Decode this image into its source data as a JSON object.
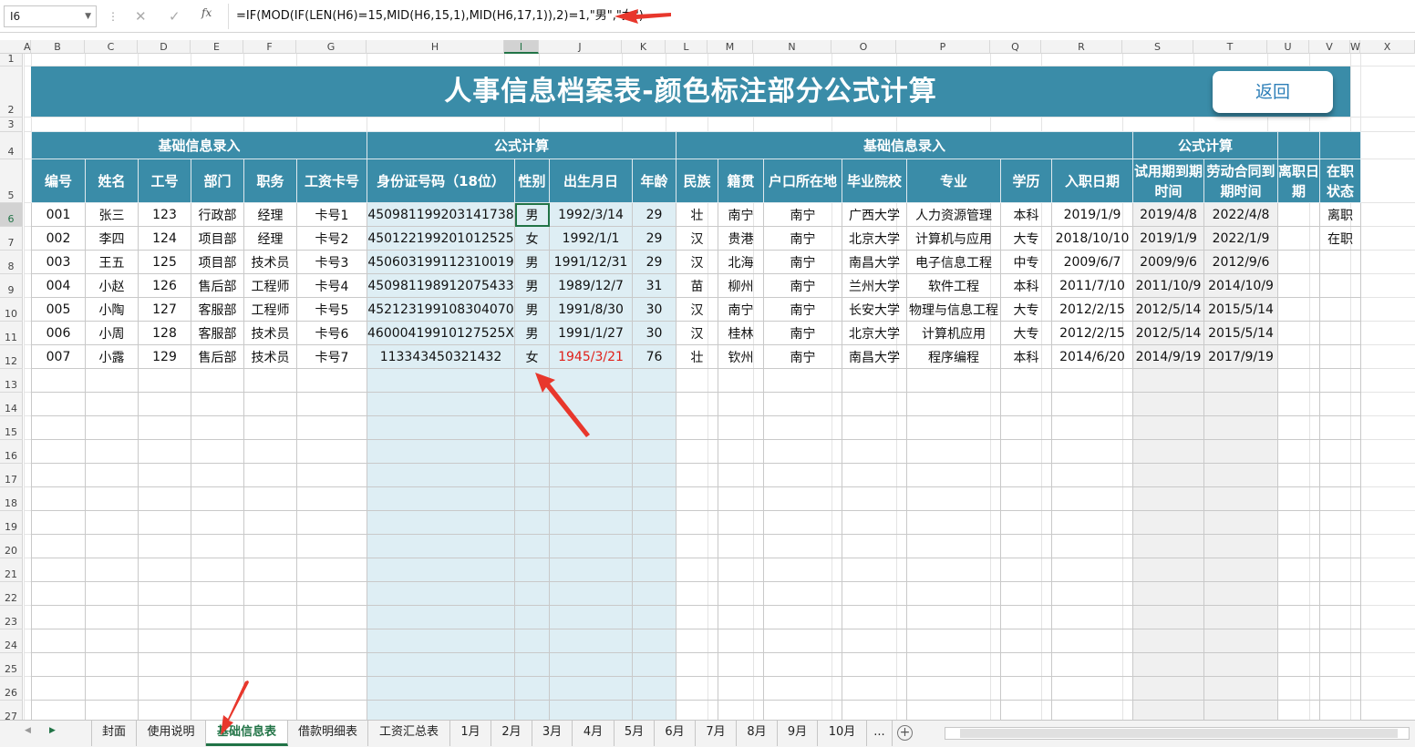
{
  "name_box": "I6",
  "formula": "=IF(MOD(IF(LEN(H6)=15,MID(H6,15,1),MID(H6,17,1)),2)=1,\"男\",\"女\")",
  "fx_label": "fx",
  "columns": [
    "A",
    "B",
    "C",
    "D",
    "E",
    "F",
    "G",
    "H",
    "I",
    "J",
    "K",
    "L",
    "M",
    "N",
    "O",
    "P",
    "Q",
    "R",
    "S",
    "T",
    "U",
    "V",
    "W",
    "X"
  ],
  "rows": [
    "1",
    "2",
    "3",
    "4",
    "5",
    "6",
    "7",
    "8",
    "9",
    "10",
    "11",
    "12",
    "13",
    "14",
    "15",
    "16",
    "17",
    "18",
    "19",
    "20",
    "21",
    "22",
    "23",
    "24",
    "25",
    "26",
    "27"
  ],
  "selected_col": "I",
  "selected_row": "6",
  "title": "人事信息档案表-颜色标注部分公式计算",
  "back_button": "返回",
  "group_headers": [
    "基础信息录入",
    "公式计算",
    "基础信息录入",
    "公式计算",
    "",
    ""
  ],
  "headers": [
    "编号",
    "姓名",
    "工号",
    "部门",
    "职务",
    "工资卡号",
    "身份证号码（18位）",
    "性别",
    "出生月日",
    "年龄",
    "民族",
    "籍贯",
    "户口所在地",
    "毕业院校",
    "专业",
    "学历",
    "入职日期",
    "试用期到期时间",
    "劳动合同到期时间",
    "离职日期",
    "在职状态"
  ],
  "table_rows": [
    [
      "001",
      "张三",
      "123",
      "行政部",
      "经理",
      "卡号1",
      "450981199203141738",
      "男",
      "1992/3/14",
      "29",
      "壮",
      "南宁",
      "南宁",
      "广西大学",
      "人力资源管理",
      "本科",
      "2019/1/9",
      "2019/4/8",
      "2022/4/8",
      "",
      "离职"
    ],
    [
      "002",
      "李四",
      "124",
      "项目部",
      "经理",
      "卡号2",
      "450122199201012525",
      "女",
      "1992/1/1",
      "29",
      "汉",
      "贵港",
      "南宁",
      "北京大学",
      "计算机与应用",
      "大专",
      "2018/10/10",
      "2019/1/9",
      "2022/1/9",
      "",
      "在职"
    ],
    [
      "003",
      "王五",
      "125",
      "项目部",
      "技术员",
      "卡号3",
      "450603199112310019",
      "男",
      "1991/12/31",
      "29",
      "汉",
      "北海",
      "南宁",
      "南昌大学",
      "电子信息工程",
      "中专",
      "2009/6/7",
      "2009/9/6",
      "2012/9/6",
      "",
      ""
    ],
    [
      "004",
      "小赵",
      "126",
      "售后部",
      "工程师",
      "卡号4",
      "450981198912075433",
      "男",
      "1989/12/7",
      "31",
      "苗",
      "柳州",
      "南宁",
      "兰州大学",
      "软件工程",
      "本科",
      "2011/7/10",
      "2011/10/9",
      "2014/10/9",
      "",
      ""
    ],
    [
      "005",
      "小陶",
      "127",
      "客服部",
      "工程师",
      "卡号5",
      "452123199108304070",
      "男",
      "1991/8/30",
      "30",
      "汉",
      "南宁",
      "南宁",
      "长安大学",
      "物理与信息工程",
      "大专",
      "2012/2/15",
      "2012/5/14",
      "2015/5/14",
      "",
      ""
    ],
    [
      "006",
      "小周",
      "128",
      "客服部",
      "技术员",
      "卡号6",
      "46000419910127525X",
      "男",
      "1991/1/27",
      "30",
      "汉",
      "桂林",
      "南宁",
      "北京大学",
      "计算机应用",
      "大专",
      "2012/2/15",
      "2012/5/14",
      "2015/5/14",
      "",
      ""
    ],
    [
      "007",
      "小露",
      "129",
      "售后部",
      "技术员",
      "卡号7",
      "113343450321432",
      "女",
      "1945/3/21",
      "76",
      "壮",
      "钦州",
      "南宁",
      "南昌大学",
      "程序编程",
      "本科",
      "2014/6/20",
      "2014/9/19",
      "2017/9/19",
      "",
      ""
    ]
  ],
  "sheet_tabs": [
    "封面",
    "使用说明",
    "基础信息表",
    "借款明细表",
    "工资汇总表",
    "1月",
    "2月",
    "3月",
    "4月",
    "5月",
    "6月",
    "7月",
    "8月",
    "9月",
    "10月",
    "..."
  ],
  "active_tab": "基础信息表",
  "colors": {
    "header_blue": "#3a8ca8",
    "formula_fill": "#deeef4",
    "excel_green": "#217346",
    "arrow_red": "#e8372c"
  }
}
